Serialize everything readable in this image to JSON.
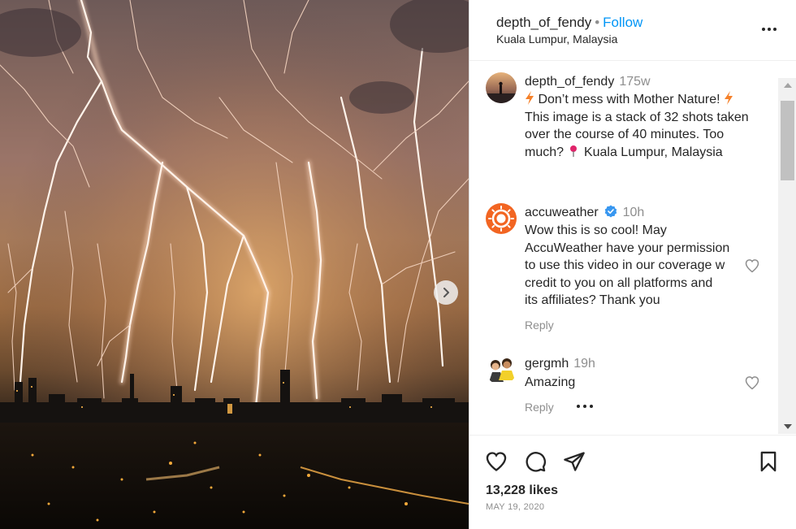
{
  "post": {
    "username": "depth_of_fendy",
    "separator": "•",
    "follow_label": "Follow",
    "location": "Kuala Lumpur, Malaysia",
    "likes": "13,228 likes",
    "date": "MAY 19, 2020"
  },
  "caption": {
    "username": "depth_of_fendy",
    "time": "175w",
    "line1": "Don’t mess with Mother Nature!",
    "line2": "This image is a stack of 32 shots taken",
    "line3": "over the course of 40 minutes. Too",
    "line4": "much?",
    "line4_rest": "Kuala Lumpur, Malaysia"
  },
  "comments": [
    {
      "username": "accuweather",
      "time": "10h",
      "lines": [
        "Wow this is so cool! May",
        "AccuWeather have your permission",
        "to use this video in our coverage w",
        "credit to you on all platforms and",
        "its affiliates? Thank you"
      ],
      "reply_label": "Reply"
    },
    {
      "username": "gergmh",
      "time": "19h",
      "lines": [
        "Amazing"
      ],
      "reply_label": "Reply"
    }
  ],
  "icons": {
    "more": "more-options-icon",
    "next": "chevron-right-icon",
    "like": "heart-icon",
    "comment": "comment-icon",
    "share": "share-icon",
    "save": "bookmark-icon",
    "verified": "verified-badge-icon",
    "bolt": "lightning-emoji",
    "pin": "pushpin-emoji"
  },
  "colors": {
    "accent": "#0095f6",
    "text": "#262626",
    "muted": "#8e8e8e",
    "accuweather_orange": "#f26522"
  }
}
